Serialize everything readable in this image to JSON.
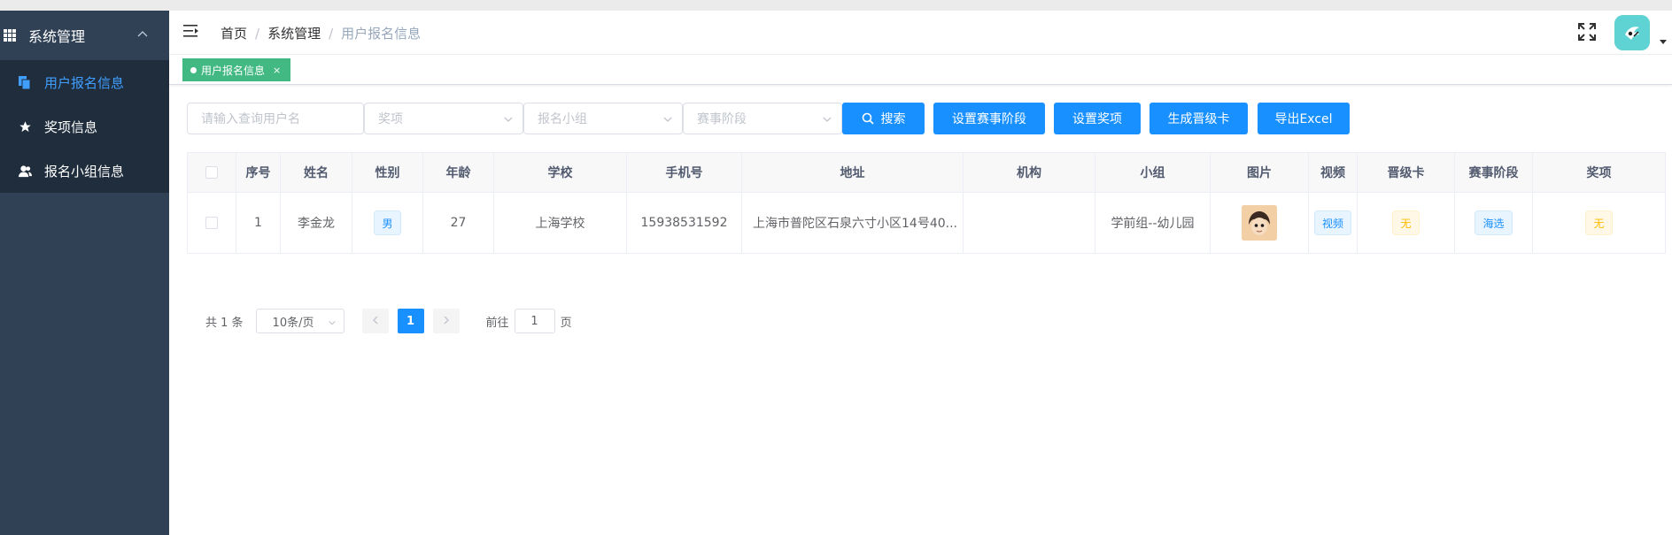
{
  "sidebar": {
    "group_label": "系统管理",
    "items": [
      {
        "label": "用户报名信息",
        "icon": "copy-icon",
        "active": true
      },
      {
        "label": "奖项信息",
        "icon": "star-icon",
        "active": false
      },
      {
        "label": "报名小组信息",
        "icon": "user-group-icon",
        "active": false
      }
    ]
  },
  "header": {
    "breadcrumb": [
      "首页",
      "系统管理",
      "用户报名信息"
    ],
    "separator": "/"
  },
  "tags_view": {
    "tabs": [
      {
        "label": "用户报名信息",
        "close": "×"
      }
    ]
  },
  "filters": {
    "username_placeholder": "请输入查询用户名",
    "award_placeholder": "奖项",
    "group_placeholder": "报名小组",
    "stage_placeholder": "赛事阶段",
    "buttons": {
      "search": "搜索",
      "set_stage": "设置赛事阶段",
      "set_award": "设置奖项",
      "gen_card": "生成晋级卡",
      "export": "导出Excel"
    }
  },
  "table": {
    "columns": [
      "序号",
      "姓名",
      "性别",
      "年龄",
      "学校",
      "手机号",
      "地址",
      "机构",
      "小组",
      "图片",
      "视频",
      "晋级卡",
      "赛事阶段",
      "奖项"
    ],
    "rows": [
      {
        "index": "1",
        "name": "李金龙",
        "gender": "男",
        "age": "27",
        "school": "上海学校",
        "phone": "15938531592",
        "address": "上海市普陀区石泉六寸小区14号40...",
        "org": "",
        "group": "学前组--幼儿园",
        "video": "视频",
        "card": "无",
        "stage": "海选",
        "award": "无"
      }
    ]
  },
  "pagination": {
    "total": "共 1 条",
    "page_size": "10条/页",
    "current_page": "1",
    "goto_label": "前往",
    "goto_value": "1",
    "page_suffix": "页"
  },
  "colors": {
    "sidebar_bg": "#304156",
    "sidebar_sub_bg": "#1f2d3d",
    "primary": "#1890ff",
    "tag_green": "#42b983",
    "active_text": "#409eff"
  }
}
